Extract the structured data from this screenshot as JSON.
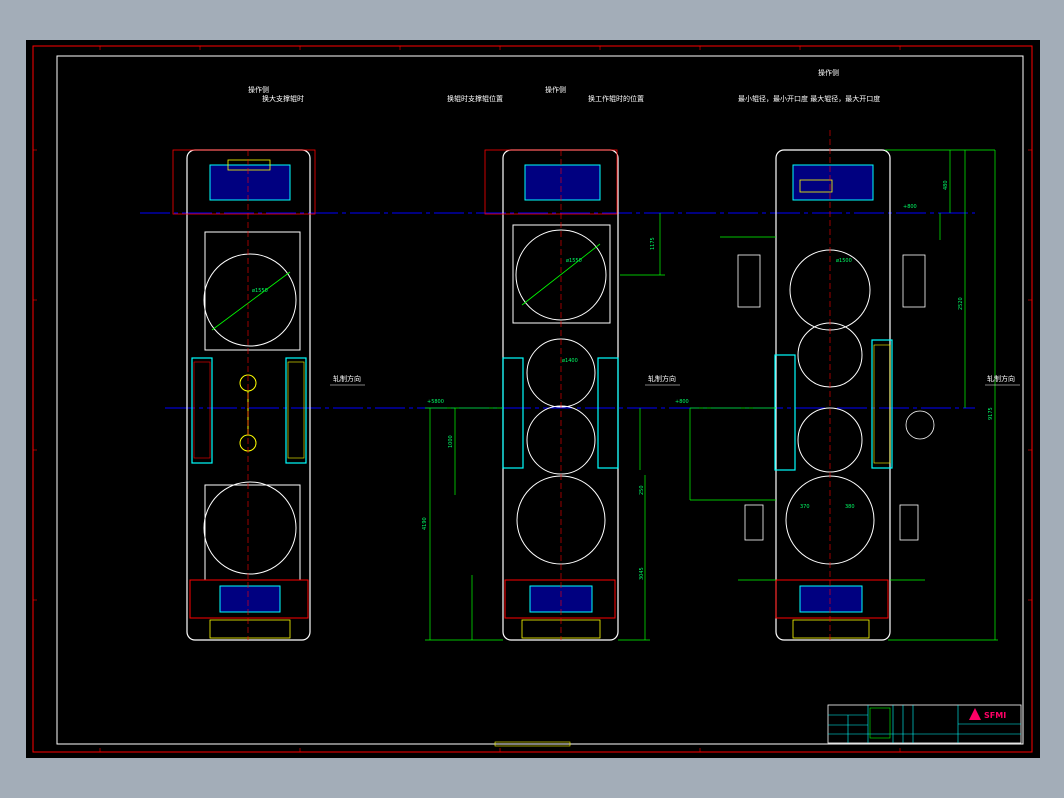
{
  "views": [
    {
      "operate_label": "操作侧",
      "caption": "换大支撑辊时",
      "direction_label": "轧制方向"
    },
    {
      "operate_label": "操作侧",
      "caption_a": "换辊时支撑辊位置",
      "caption_b": "换工作辊时的位置",
      "direction_label": "轧制方向"
    },
    {
      "operate_label": "操作侧",
      "caption": "最小辊径，最小开口度   最大辊径，最大开口度",
      "direction_label": "轧制方向"
    }
  ],
  "dimensions": {
    "roll_dia_1": "ø1550",
    "roll_dia_2": "ø1550",
    "roll_dia_3": "ø1400",
    "roll_dia_4": "ø1500",
    "level_1": "+5800",
    "level_2": "+800",
    "level_3": "+800",
    "dim_250": "250",
    "dim_480": "480",
    "dim_4190": "4190",
    "dim_3045": "3045",
    "dim_1175": "1175",
    "dim_1000": "1000",
    "dim_9175": "9175",
    "dim_2520": "2520",
    "dim_370": "370",
    "dim_380": "380"
  },
  "title_block": {
    "company_logo": "SFMI"
  },
  "colors": {
    "background": "#000000",
    "frame": "#ff0000",
    "outline": "#ffffff",
    "centerline": "#0000ff",
    "dimension": "#00ff00",
    "part": "#00ffff"
  }
}
